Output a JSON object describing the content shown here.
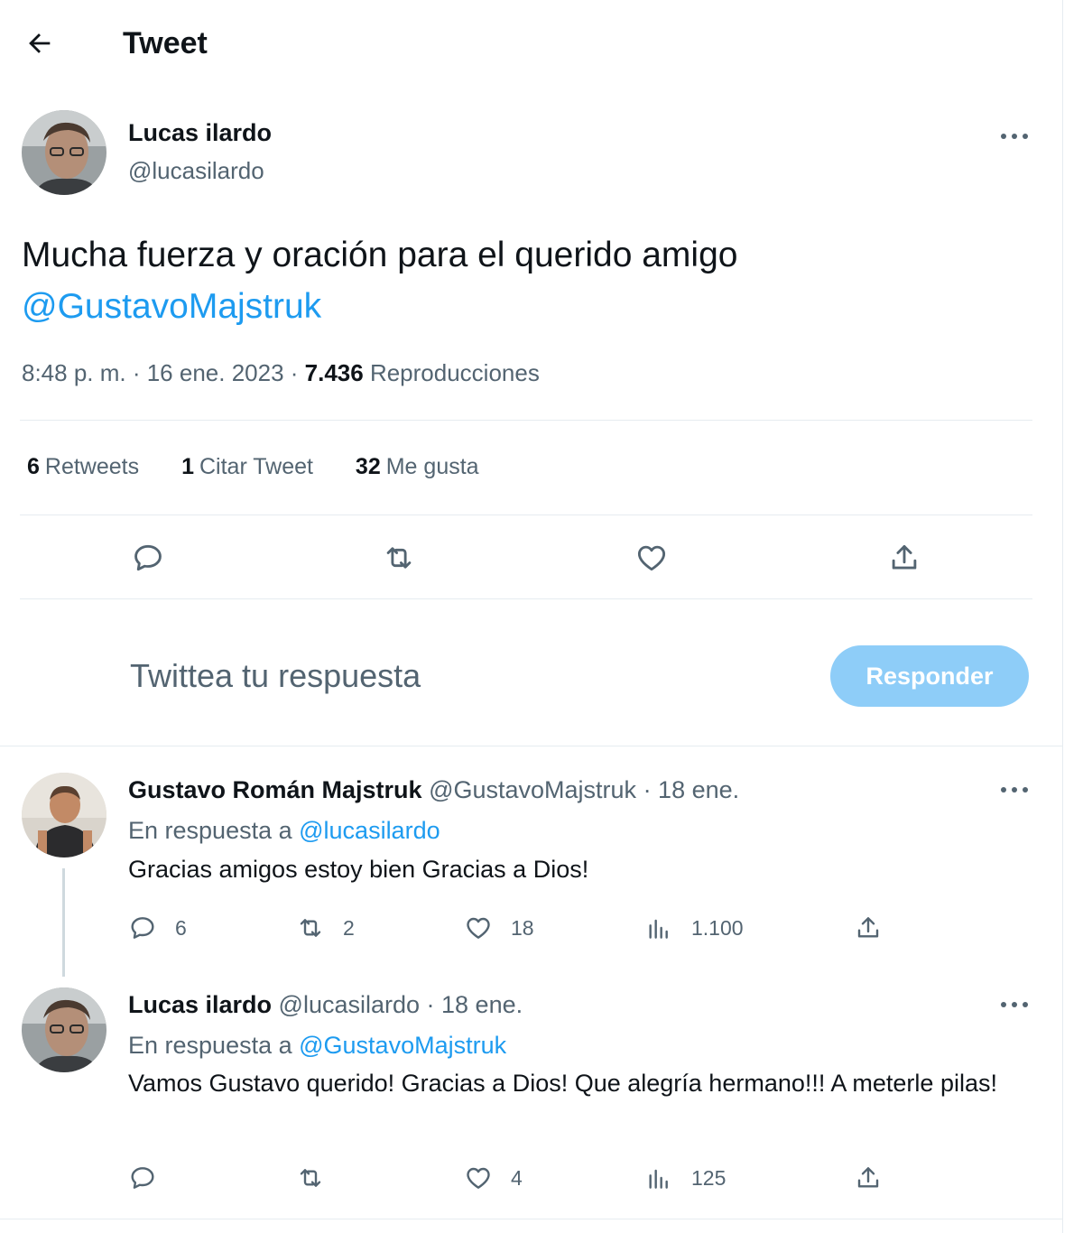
{
  "header": {
    "title": "Tweet"
  },
  "main_tweet": {
    "name": "Lucas ilardo",
    "handle": "@lucasilardo",
    "text": "Mucha fuerza y oración para el querido amigo",
    "mention": "@GustavoMajstruk",
    "time": "8:48 p. m. · 16 ene. 2023 · ",
    "views_count": "7.436",
    "views_label": " Reproducciones",
    "stats": [
      {
        "count": "6",
        "label": "Retweets"
      },
      {
        "count": "1",
        "label": "Citar Tweet"
      },
      {
        "count": "32",
        "label": "Me gusta"
      }
    ],
    "actions": [
      "reply-icon",
      "retweet-icon",
      "like-icon",
      "share-icon"
    ]
  },
  "composer": {
    "placeholder": "Twittea tu respuesta",
    "button_label": "Responder",
    "button_color": "#8ecdf8"
  },
  "replies": [
    {
      "name": "Gustavo Román Majstruk",
      "handle": " @GustavoMajstruk",
      "date": " · 18 ene.",
      "reply_to_prefix": "En respuesta a ",
      "reply_to_handle": "@lucasilardo",
      "text": "Gracias amigos estoy bien Gracias a Dios!",
      "replies": "6",
      "retweets": "2",
      "likes": "18",
      "views": "1.100"
    },
    {
      "name": "Lucas ilardo",
      "handle": " @lucasilardo",
      "date": " · 18 ene.",
      "reply_to_prefix": "En respuesta a ",
      "reply_to_handle": "@GustavoMajstruk",
      "text": "Vamos Gustavo querido! Gracias  a Dios! Que alegría hermano!!! A meterle pilas!",
      "replies": "",
      "retweets": "",
      "likes": "4",
      "views": "125"
    }
  ],
  "colors": {
    "accent": "#1d9bf0",
    "text": "#0f1419",
    "secondary": "#536471",
    "divider": "#e6ecf0"
  }
}
